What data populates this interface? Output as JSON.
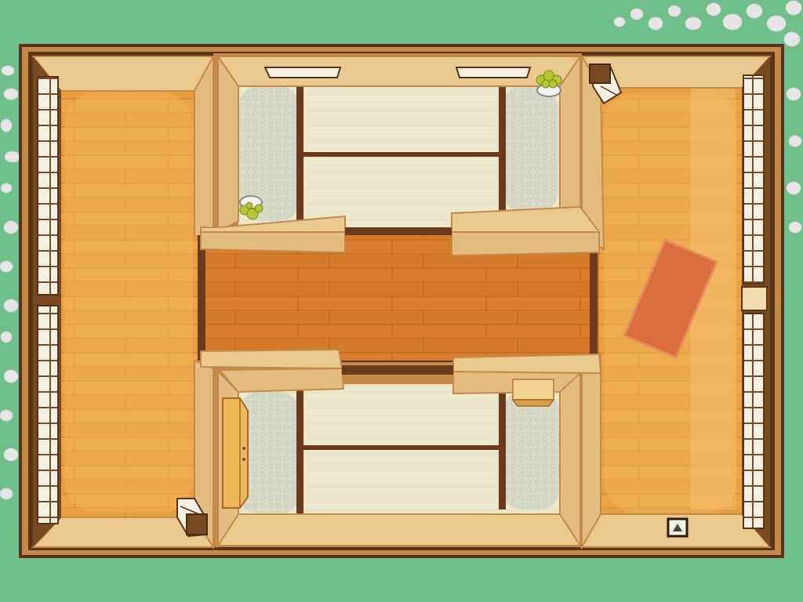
{
  "screen": "top-down-japanese-house-escape-room",
  "colors": {
    "grass": "#6fbf8a",
    "grass_dark": "#5aa874",
    "pebble": "#e6e6e6",
    "outer_frame": "#5a3418",
    "wall_trim": "#c58a4a",
    "wall_face": "#e9c98f",
    "wood_floor": "#e99a3c",
    "wood_floor_dark": "#cf7a2a",
    "tatami": "#e9e6c8",
    "tatami_border": "#6b3a1c",
    "shoji_paper": "#f6f1e2",
    "rug": "#d7643a",
    "plant": "#b7c732"
  },
  "rooms": {
    "left_corridor": {
      "floor": "wood"
    },
    "right_corridor": {
      "floor": "wood"
    },
    "center_hall": {
      "floor": "wood"
    },
    "upper_tatami_room": {
      "floor": "tatami"
    },
    "lower_tatami_room": {
      "floor": "tatami"
    }
  },
  "objects": [
    {
      "name": "lantern-top-right",
      "icon": "lantern-icon"
    },
    {
      "name": "lantern-bottom-left",
      "icon": "lantern-icon"
    },
    {
      "name": "potted-plant-top-right",
      "icon": "plant-icon"
    },
    {
      "name": "potted-plant-upper-room",
      "icon": "plant-icon"
    },
    {
      "name": "wardrobe-lower-room",
      "icon": "wardrobe-icon"
    },
    {
      "name": "small-table-lower-room",
      "icon": "table-icon"
    },
    {
      "name": "rug-right-corridor",
      "icon": "rug-icon"
    },
    {
      "name": "picture-frame-bottom-right",
      "icon": "picture-icon"
    },
    {
      "name": "ceiling-light-left",
      "icon": "light-icon"
    },
    {
      "name": "ceiling-light-right",
      "icon": "light-icon"
    }
  ]
}
